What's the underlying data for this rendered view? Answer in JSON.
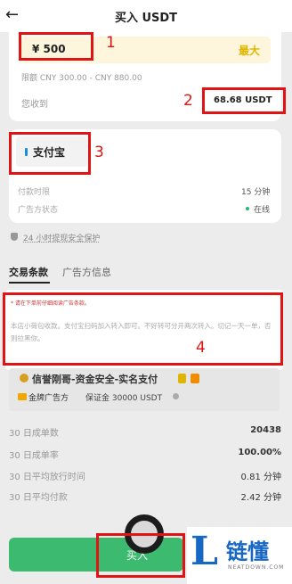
{
  "header": {
    "back_glyph": "←",
    "title": "买入 USDT"
  },
  "amount": {
    "value": "¥ 500",
    "max_label": "最大",
    "limit": "限额 CNY 300.00 - CNY 880.00",
    "receive_label": "您收到",
    "receive_value": "68.68 USDT"
  },
  "payment": {
    "method": "支付宝",
    "time_label": "付款时限",
    "time_value": "15 分钟",
    "status_label": "广告方状态",
    "status_value": "在线"
  },
  "guarantee": "24 小时提现安全保护",
  "tabs": {
    "terms": "交易条款",
    "info": "广告方信息"
  },
  "terms": {
    "line1": "* 请在下单前仔细阅读广告条款。",
    "body": "本店小荷包收款。支付宝扫码加入转入即可。不好转可分开两次转入。切记一天一单，否则拉黑你。"
  },
  "advertiser": {
    "name": "信誉刚哥-资金安全-实名支付",
    "badge": "金牌广告方",
    "deposit": "保证金 30000 USDT"
  },
  "stats": [
    {
      "label": "30 日成单数",
      "value": "20438"
    },
    {
      "label": "30 日成单率",
      "value": "100.00%"
    },
    {
      "label": "30 日平均放行时间",
      "value": "0.81 分钟"
    },
    {
      "label": "30 日平均付款",
      "value": "2.42 分钟"
    }
  ],
  "buttons": {
    "buy_label": "买入"
  },
  "annotations": [
    "1",
    "2",
    "3",
    "4"
  ],
  "watermark": {
    "text": "链懂",
    "sub": "NEATDOWN.COM"
  },
  "colors": {
    "annotation_red": "#e01414",
    "accent_yellow": "#e0b500",
    "buy_green": "#3cba70",
    "logo_blue": "#1767c4"
  }
}
